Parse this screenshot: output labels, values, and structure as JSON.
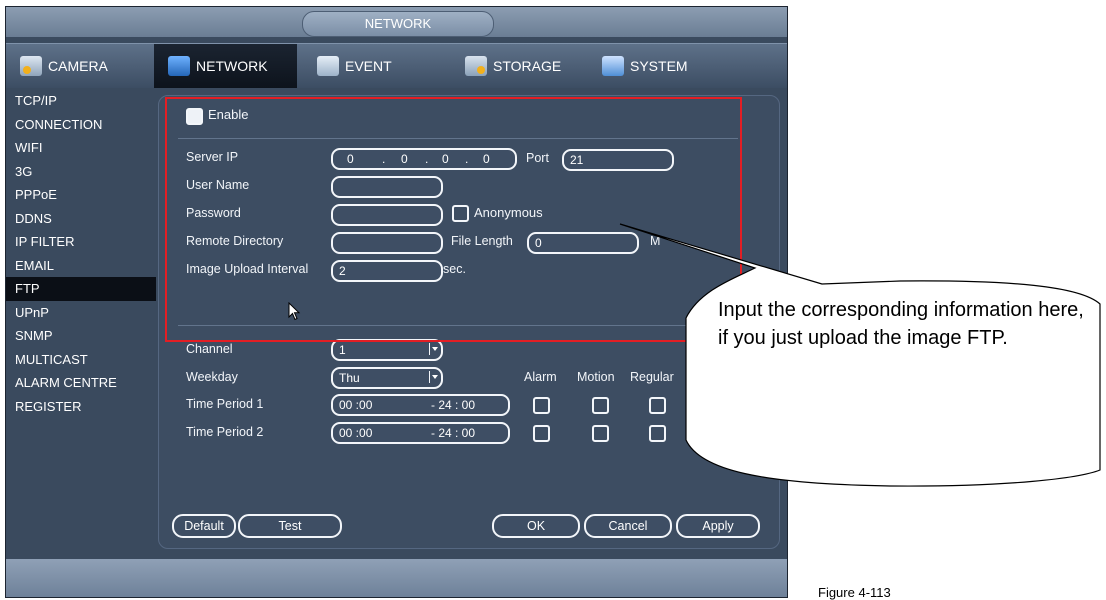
{
  "window": {
    "title": "NETWORK"
  },
  "tabs": [
    {
      "label": "CAMERA",
      "icon": "camera-icon"
    },
    {
      "label": "NETWORK",
      "icon": "network-icon",
      "active": true
    },
    {
      "label": "EVENT",
      "icon": "event-icon"
    },
    {
      "label": "STORAGE",
      "icon": "storage-icon"
    },
    {
      "label": "SYSTEM",
      "icon": "system-icon"
    }
  ],
  "sidebar": {
    "items": [
      {
        "label": "TCP/IP"
      },
      {
        "label": "CONNECTION"
      },
      {
        "label": "WIFI"
      },
      {
        "label": "3G"
      },
      {
        "label": "PPPoE"
      },
      {
        "label": "DDNS"
      },
      {
        "label": "IP FILTER"
      },
      {
        "label": "EMAIL"
      },
      {
        "label": "FTP",
        "active": true
      },
      {
        "label": "UPnP"
      },
      {
        "label": "SNMP"
      },
      {
        "label": "MULTICAST"
      },
      {
        "label": "ALARM CENTRE"
      },
      {
        "label": "REGISTER"
      }
    ]
  },
  "ftp": {
    "enable_label": "Enable",
    "server_ip_label": "Server IP",
    "server_ip": [
      "0",
      "0",
      "0",
      "0"
    ],
    "ip_sep": ".",
    "port_label": "Port",
    "port_value": "21",
    "username_label": "User Name",
    "username_value": "",
    "password_label": "Password",
    "password_value": "",
    "anonymous_label": "Anonymous",
    "remote_dir_label": "Remote Directory",
    "remote_dir_value": "",
    "file_length_label": "File Length",
    "file_length_value": "0",
    "file_length_unit": "M",
    "upload_interval_label": "Image Upload Interval",
    "upload_interval_value": "2",
    "upload_interval_unit": "sec.",
    "channel_label": "Channel",
    "channel_value": "1",
    "weekday_label": "Weekday",
    "weekday_value": "Thu",
    "col_alarm": "Alarm",
    "col_motion": "Motion",
    "col_regular": "Regular",
    "periods": [
      {
        "label": "Time Period 1",
        "start": "00 :00",
        "end": "- 24 : 00"
      },
      {
        "label": "Time Period 2",
        "start": "00 :00",
        "end": "- 24 : 00"
      }
    ]
  },
  "buttons": {
    "default": "Default",
    "test": "Test",
    "ok": "OK",
    "cancel": "Cancel",
    "apply": "Apply"
  },
  "annotation": {
    "callout_text": "Input the corresponding information here, if you just upload the image FTP.",
    "box_color": "#e31e24"
  },
  "caption": "Figure 4-113"
}
